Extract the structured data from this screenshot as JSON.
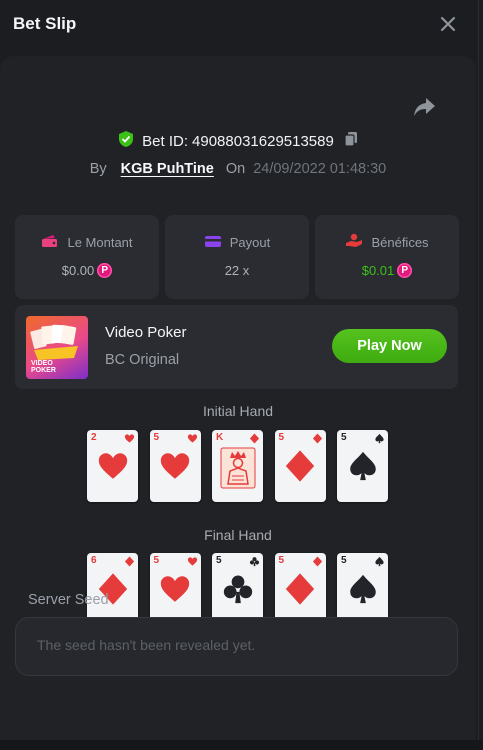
{
  "header": {
    "title": "Bet Slip"
  },
  "bet": {
    "id_label": "Bet ID:",
    "id": "49088031629513589",
    "by_label": "By",
    "username": "KGB PuhTine",
    "on_label": "On",
    "datetime": "24/09/2022 01:48:30"
  },
  "stats": {
    "amount": {
      "label": "Le Montant",
      "value": "$0.00"
    },
    "payout": {
      "label": "Payout",
      "value": "22 x"
    },
    "profit": {
      "label": "Bénéfices",
      "value": "$0.01"
    }
  },
  "game": {
    "name": "Video Poker",
    "provider": "BC Original",
    "thumb_text_line1": "VIDEO",
    "thumb_text_line2": "POKER",
    "play_label": "Play Now"
  },
  "hands": {
    "initial_title": "Initial Hand",
    "initial": [
      {
        "rank": "2",
        "suit": "hearts"
      },
      {
        "rank": "5",
        "suit": "hearts"
      },
      {
        "rank": "K",
        "suit": "diamonds"
      },
      {
        "rank": "5",
        "suit": "diamonds"
      },
      {
        "rank": "5",
        "suit": "spades"
      }
    ],
    "final_title": "Final Hand",
    "final": [
      {
        "rank": "6",
        "suit": "diamonds"
      },
      {
        "rank": "5",
        "suit": "hearts"
      },
      {
        "rank": "5",
        "suit": "clubs"
      },
      {
        "rank": "5",
        "suit": "diamonds"
      },
      {
        "rank": "5",
        "suit": "spades"
      }
    ]
  },
  "seed": {
    "label": "Server Seed",
    "placeholder": "The seed hasn't been revealed yet."
  },
  "colors": {
    "accent_green": "#3bc117",
    "coin_pink": "#e0197d",
    "suit_red": "#e53b3b",
    "suit_black": "#22242a"
  }
}
